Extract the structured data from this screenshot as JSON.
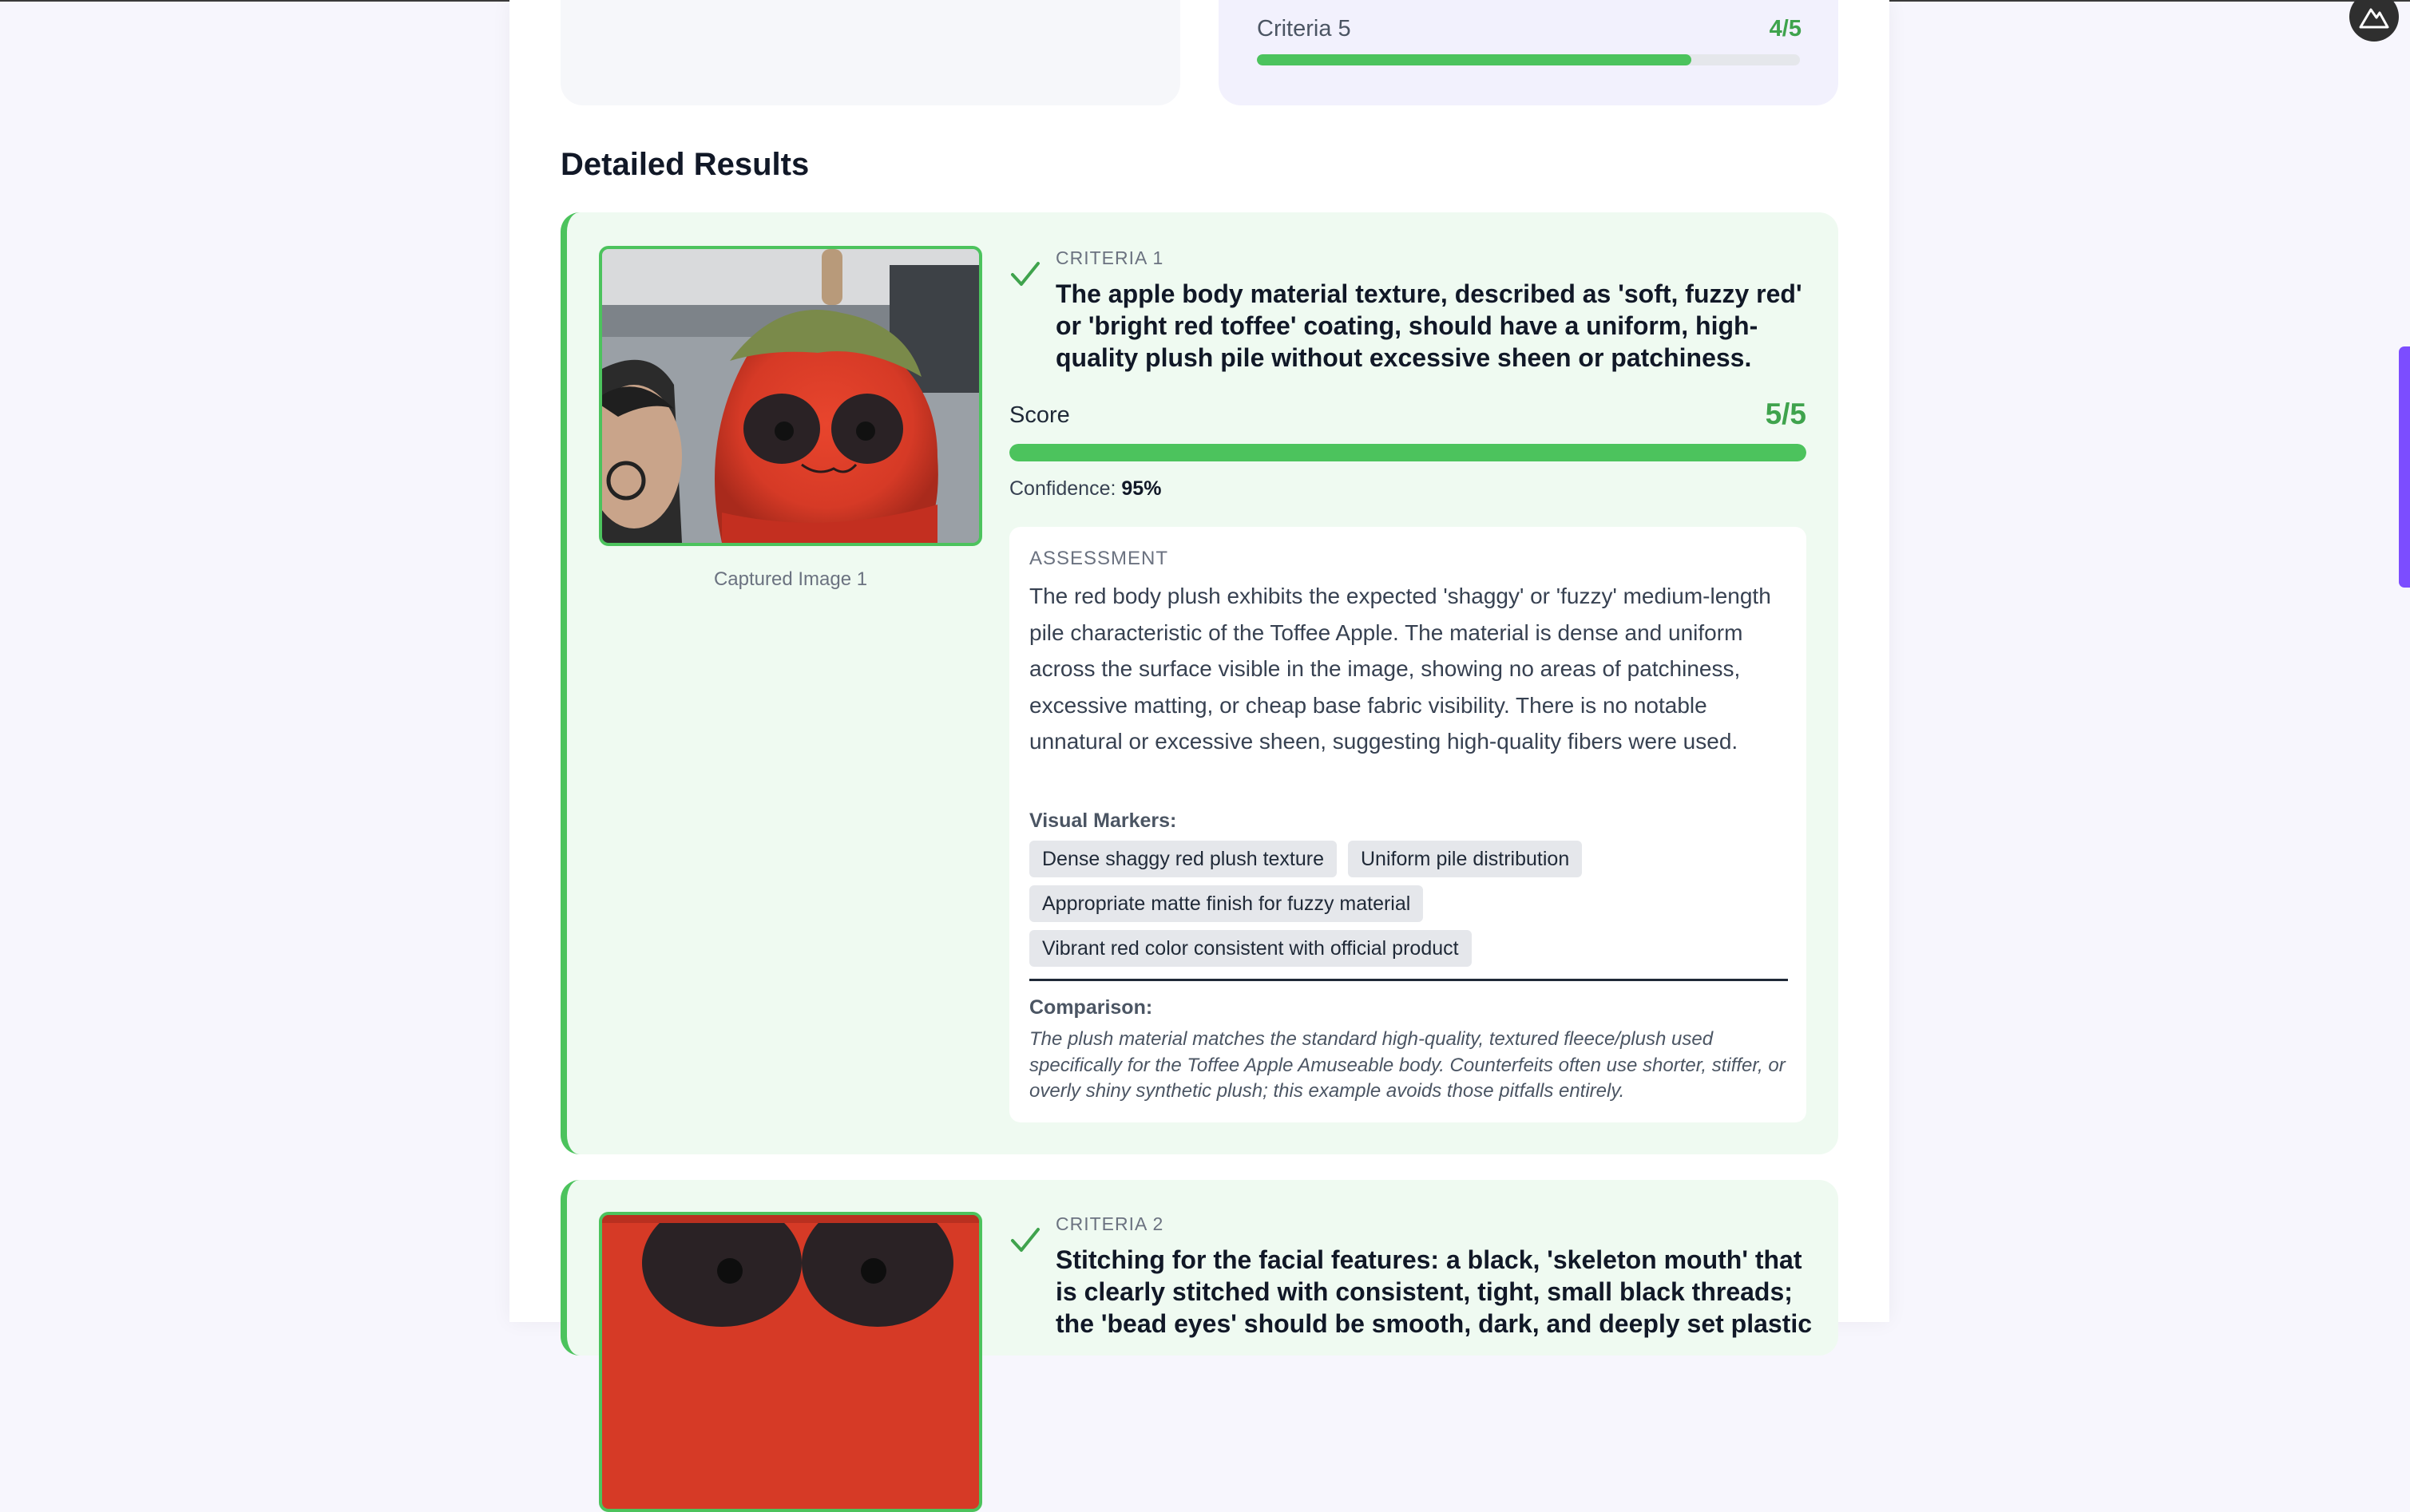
{
  "summary": {
    "criteria5": {
      "label": "Criteria 5",
      "score_text": "4/5",
      "score_fraction": 0.8
    }
  },
  "section_title": "Detailed Results",
  "criteria": [
    {
      "label": "CRITERIA 1",
      "title": "The apple body material texture, described as 'soft, fuzzy red' or 'bright red toffee' coating, should have a uniform, high-quality plush pile without excessive sheen or patchiness.",
      "status": "pass",
      "image_caption": "Captured Image 1",
      "score_label": "Score",
      "score_text": "5/5",
      "score_fraction": 1.0,
      "confidence_label": "Confidence:",
      "confidence_value": "95%",
      "assessment_label": "ASSESSMENT",
      "assessment": "The red body plush exhibits the expected 'shaggy' or 'fuzzy' medium-length pile characteristic of the Toffee Apple. The material is dense and uniform across the surface visible in the image, showing no areas of patchiness, excessive matting, or cheap base fabric visibility. There is no notable unnatural or excessive sheen, suggesting high-quality fibers were used.",
      "visual_markers_label": "Visual Markers:",
      "visual_markers": [
        "Dense shaggy red plush texture",
        "Uniform pile distribution",
        "Appropriate matte finish for fuzzy material",
        "Vibrant red color consistent with official product"
      ],
      "comparison_label": "Comparison:",
      "comparison": "The plush material matches the standard high-quality, textured fleece/plush used specifically for the Toffee Apple Amuseable body. Counterfeits often use shorter, stiffer, or overly shiny synthetic plush; this example avoids those pitfalls entirely."
    },
    {
      "label": "CRITERIA 2",
      "title": "Stitching for the facial features: a black, 'skeleton mouth' that is clearly stitched with consistent, tight, small black threads; the 'bead eyes' should be smooth, dark, and deeply set plastic",
      "status": "pass"
    }
  ],
  "colors": {
    "accent_green": "#4cc35d",
    "score_green": "#3fa34d",
    "card_background": "#effaf1",
    "scroll_accent": "#7c4dff"
  },
  "icons": {
    "pass": "check-icon",
    "corner_button": "mountain-logo-icon"
  }
}
